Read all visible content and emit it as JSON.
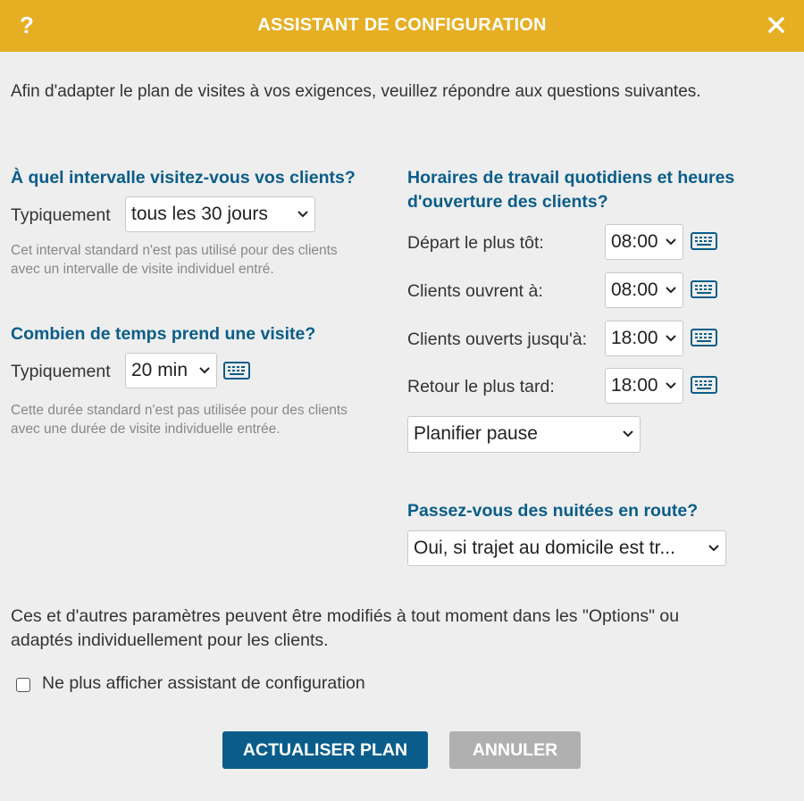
{
  "dialog": {
    "help_label": "?",
    "title": "ASSISTANT DE CONFIGURATION",
    "intro": "Afin d'adapter le plan de visites à vos exigences, veuillez répondre aux questions suivantes."
  },
  "interval": {
    "heading": "À quel intervalle visitez-vous vos clients?",
    "label": "Typiquement",
    "selected": "tous les 30 jours",
    "note_line1": "Cet interval standard n'est pas utilisé pour des clients",
    "note_line2": "avec un intervalle de visite individuel entré."
  },
  "duration": {
    "heading": "Combien de temps prend une visite?",
    "label": "Typiquement",
    "selected": "20 min",
    "note_line1": "Cette durée standard n'est pas utilisée pour des clients",
    "note_line2": "avec une durée de visite individuelle entrée."
  },
  "hours": {
    "heading_line1": "Horaires de travail quotidiens et heures",
    "heading_line2": "d'ouverture des clients?",
    "rows": [
      {
        "label": "Départ le plus tôt:",
        "value": "08:00"
      },
      {
        "label": "Clients ouvrent à:",
        "value": "08:00"
      },
      {
        "label": "Clients ouverts jusqu'à:",
        "value": "18:00"
      },
      {
        "label": "Retour le plus tard:",
        "value": "18:00"
      }
    ],
    "pause_selected": "Planifier pause"
  },
  "overnight": {
    "heading": "Passez-vous des nuitées en route?",
    "selected": "Oui, si trajet au domicile est tr..."
  },
  "footer": {
    "info_line1": "Ces et d'autres paramètres peuvent être modifiés à tout moment dans les \"Options\" ou",
    "info_line2": "adaptés individuellement pour les clients.",
    "checkbox_label": "Ne plus afficher assistant de configuration",
    "checkbox_checked": false,
    "update_button": "ACTUALISER PLAN",
    "cancel_button": "ANNULER"
  },
  "colors": {
    "titlebar": "#e6ae22",
    "heading": "#0a5d8a",
    "primary_button": "#0a5d8a",
    "secondary_button": "#b0b0b0"
  },
  "icons": [
    "help-icon",
    "close-icon",
    "chevron-down-icon",
    "keyboard-icon"
  ]
}
